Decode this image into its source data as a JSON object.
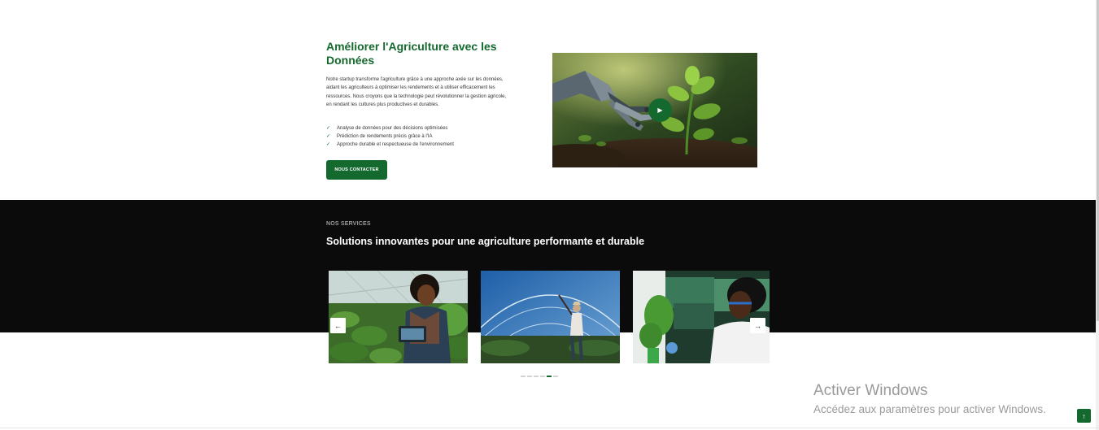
{
  "about": {
    "title": "Améliorer l'Agriculture avec les Données",
    "paragraph": "Notre startup transforme l'agriculture grâce à une approche axée sur les données, aidant les agriculteurs à optimiser les rendements et à utiliser efficacement les ressources. Nous croyons que la technologie peut révolutionner la gestion agricole, en rendant les cultures plus productives et durables.",
    "features": [
      "Analyse de données pour des décisions optimisées",
      "Prédiction de rendements précis grâce à l'IA",
      "Approche durable et respectueuse de l'environnement"
    ],
    "cta_label": "NOUS CONTACTER",
    "video_icon": "play-icon"
  },
  "services": {
    "eyebrow": "NOS SERVICES",
    "title": "Solutions innovantes pour une agriculture performante et durable",
    "prev_icon": "arrow-left-icon",
    "next_icon": "arrow-right-icon",
    "slide_count": 6,
    "active_slide": 4
  },
  "windows_notice": {
    "title": "Activer Windows",
    "subtitle": "Accédez aux paramètres pour activer Windows."
  },
  "back_to_top_icon": "arrow-up-icon",
  "colors": {
    "brand_green": "#14692f",
    "services_background": "#0b0b0b"
  }
}
